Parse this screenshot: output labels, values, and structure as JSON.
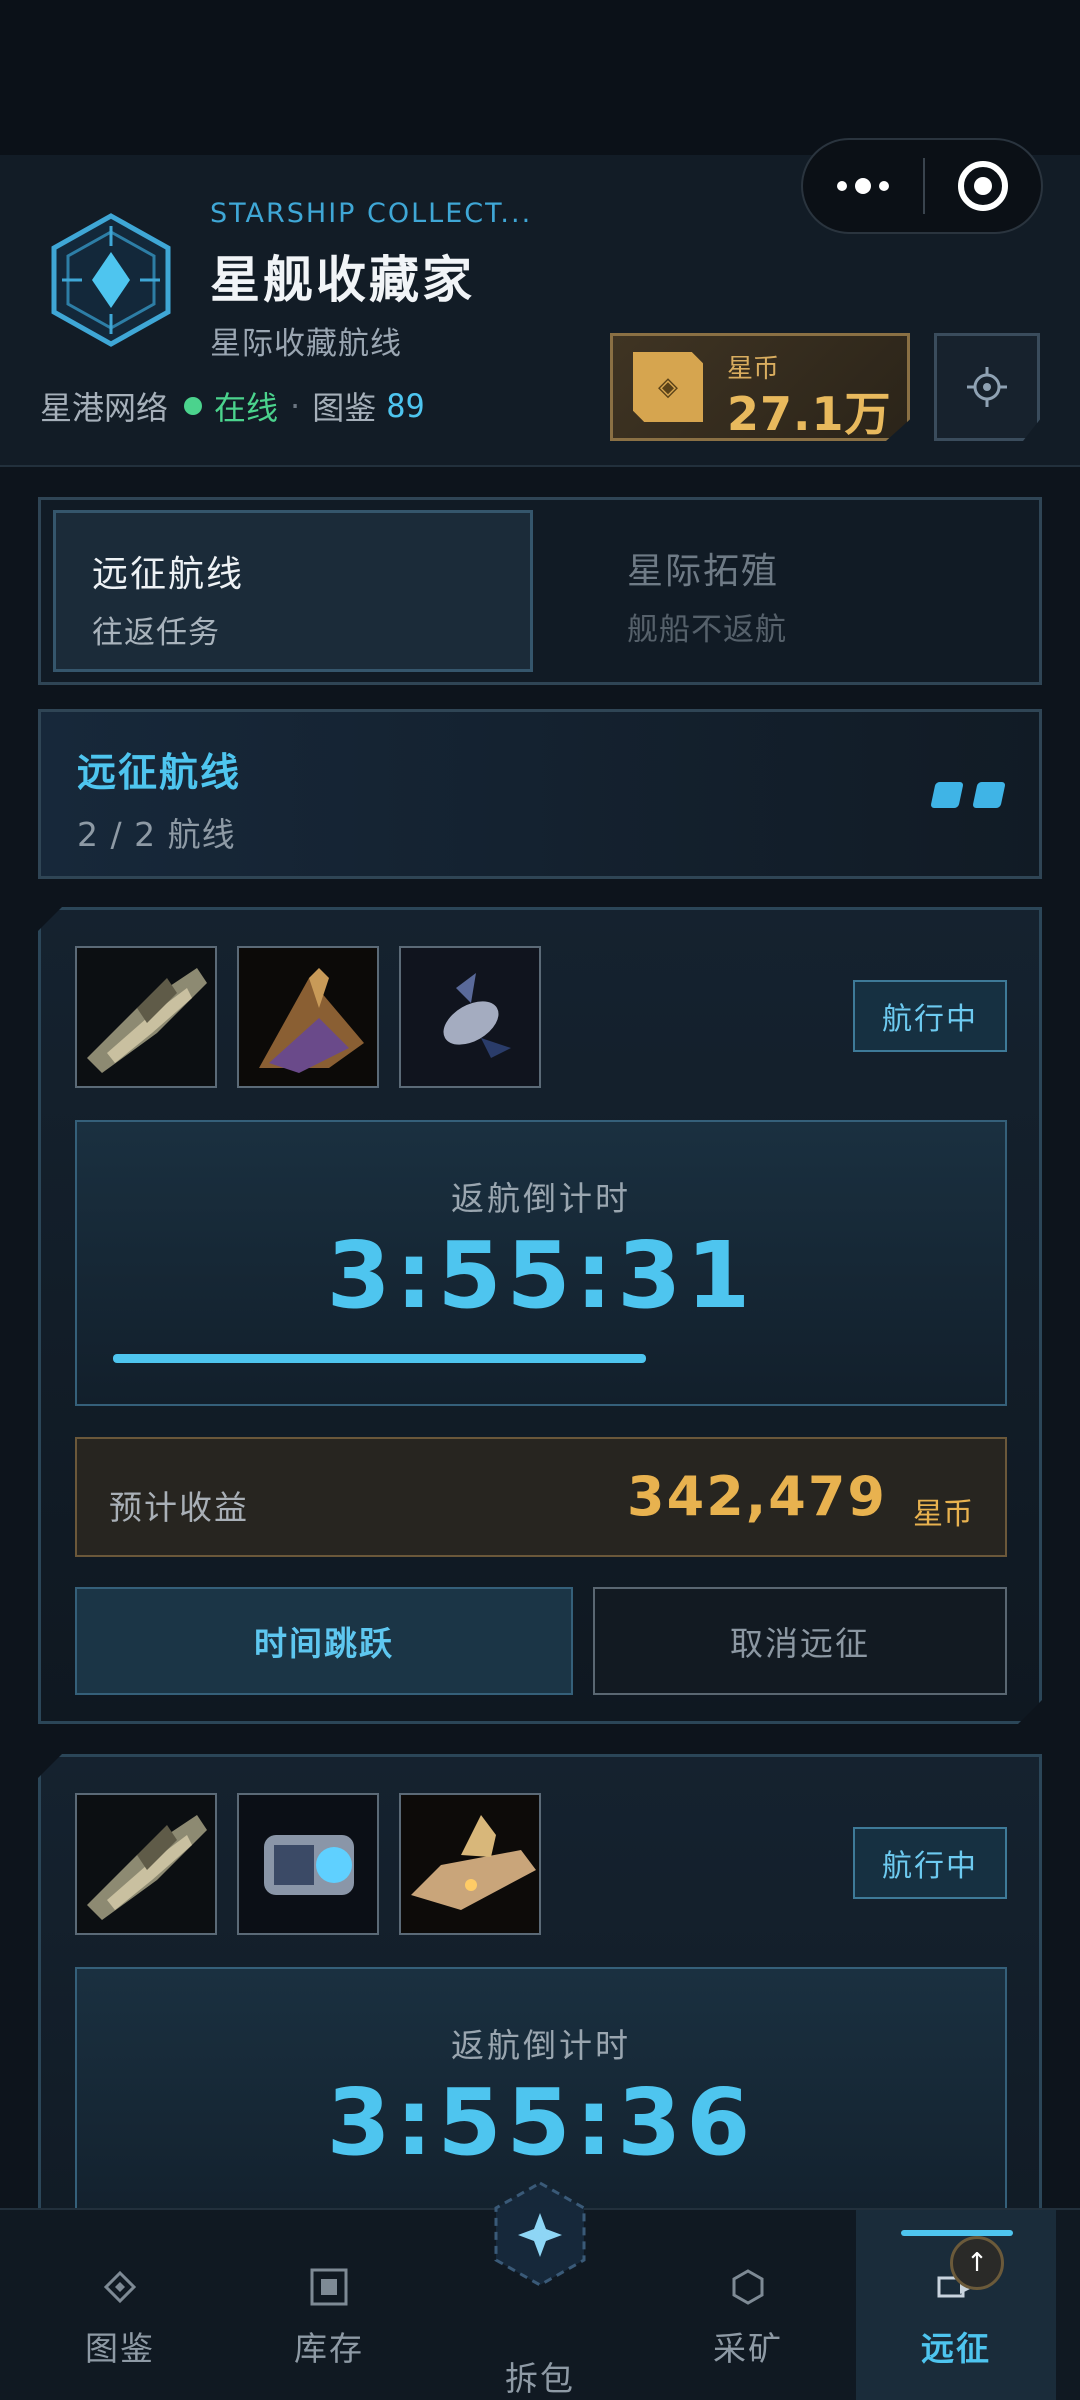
{
  "menu_capsule": {
    "more_icon": "more-dots-icon",
    "close_icon": "target-icon"
  },
  "header": {
    "subtitle_en": "STARSHIP COLLECT...",
    "title": "星舰收藏家",
    "subtitle": "星际收藏航线",
    "network_label": "星港网络",
    "status": "在线",
    "separator": "·",
    "catalog_label": "图鉴",
    "catalog_count": "89"
  },
  "wallet": {
    "label": "星币",
    "value": "27.1万",
    "icon": "coin-diamond-icon"
  },
  "mode_tabs": [
    {
      "title": "远征航线",
      "subtitle": "往返任务",
      "active": true
    },
    {
      "title": "星际拓殖",
      "subtitle": "舰船不返航",
      "active": false
    }
  ],
  "route_summary": {
    "title": "远征航线",
    "count": "2 / 2 航线",
    "slots_filled": 2
  },
  "expeditions": [
    {
      "status": "航行中",
      "timer_label": "返航倒计时",
      "timer": "3:55:31",
      "progress": 0.62,
      "profit_label": "预计收益",
      "profit_value": "342,479",
      "profit_unit": "星币",
      "warp_label": "时间跳跃",
      "cancel_label": "取消远征"
    },
    {
      "status": "航行中",
      "timer_label": "返航倒计时",
      "timer": "3:55:36"
    }
  ],
  "tabbar": [
    {
      "label": "图鉴",
      "icon": "diamond-icon"
    },
    {
      "label": "库存",
      "icon": "box-icon"
    },
    {
      "label": "拆包",
      "icon": "sparkle-hex-icon"
    },
    {
      "label": "采矿",
      "icon": "hexagon-icon"
    },
    {
      "label": "远征",
      "icon": "expedition-icon",
      "active": true
    }
  ],
  "colors": {
    "accent": "#4ec5ef",
    "gold": "#e8b24f",
    "online": "#4bd38d",
    "background": "#0d141c"
  }
}
